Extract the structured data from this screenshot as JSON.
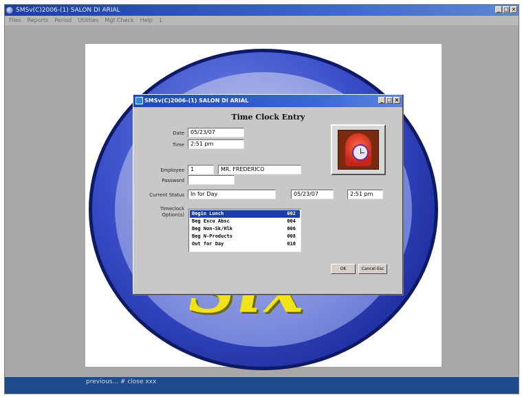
{
  "app": {
    "title": "SMSv(C)2006-(1) SALON DI ARIAL",
    "menu": [
      "Files",
      "Reports",
      "Period",
      "Utilities",
      "Mgt Check",
      "Help",
      "1"
    ],
    "window_buttons": [
      "_",
      "□",
      "×"
    ],
    "status_text": "previous... # close xxx"
  },
  "background": {
    "logo_text": "Six"
  },
  "dialog": {
    "title": "SMSv(C)2006-(1) SALON DI ARIAL",
    "heading": "Time Clock Entry",
    "window_buttons": [
      "_",
      "□",
      "×"
    ],
    "date": {
      "label": "Date",
      "value": "05/23/07"
    },
    "time": {
      "label": "Time",
      "value": "2:51 pm"
    },
    "employee": {
      "label": "Employee",
      "id": "1",
      "name": "MR. FREDERICO"
    },
    "password": {
      "label": "Password",
      "value": ""
    },
    "current_status": {
      "label": "Current Status",
      "status": "In for Day",
      "date": "05/23/07",
      "time": "2:51 pm"
    },
    "options": {
      "label_line1": "Timeclock",
      "label_line2": "Option(s)",
      "items": [
        {
          "label": "Begin Lunch",
          "code": "002"
        },
        {
          "label": "Beg Excu Absc",
          "code": "004"
        },
        {
          "label": "Beg Non-Sk/Hlk",
          "code": "006"
        },
        {
          "label": "Beg N-Products",
          "code": "008"
        },
        {
          "label": "Out for Day",
          "code": "010"
        }
      ]
    },
    "ok_label": "OK",
    "cancel_label": "Cancel-Esc"
  },
  "colors": {
    "titlebar": "#1c3f9c",
    "selection": "#1a3fa8",
    "logo_yellow": "#f2e21a",
    "logo_blue": "#2a3cb8"
  }
}
